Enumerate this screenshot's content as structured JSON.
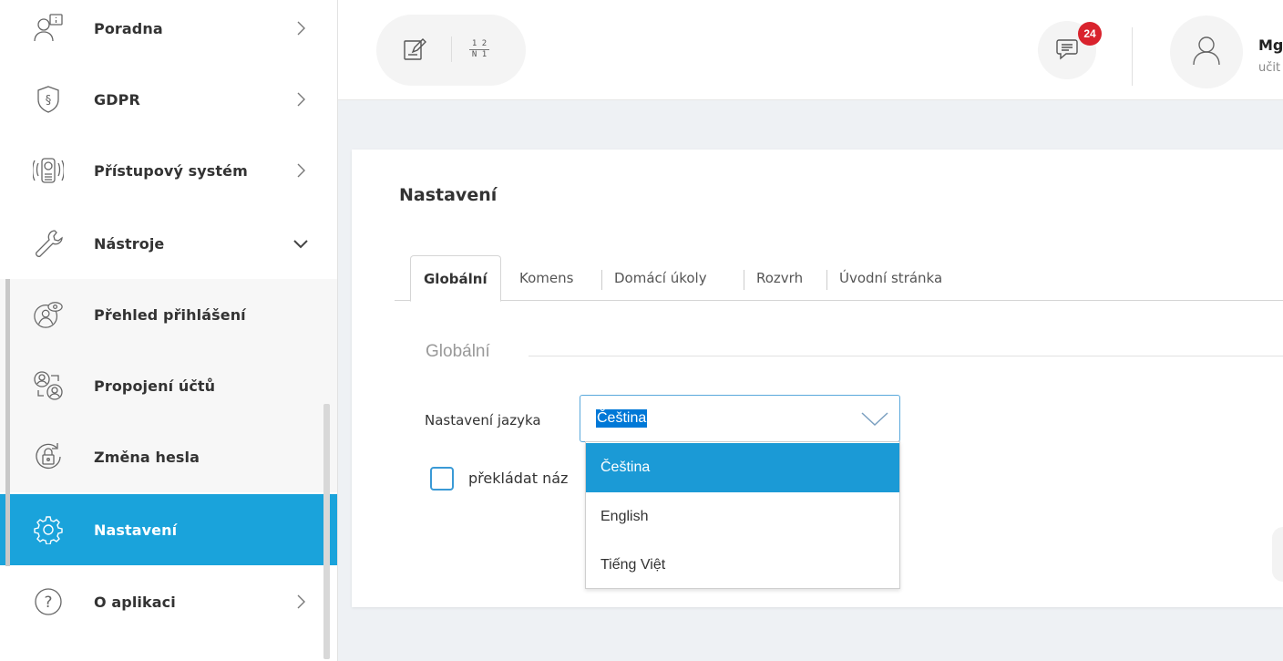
{
  "sidebar": {
    "items": [
      {
        "label": "Poradna",
        "icon": "advice-icon",
        "chevron": "right"
      },
      {
        "label": "GDPR",
        "icon": "gdpr-shield-icon",
        "chevron": "right"
      },
      {
        "label": "Přístupový systém",
        "icon": "access-system-icon",
        "chevron": "right"
      },
      {
        "label": "Nástroje",
        "icon": "wrench-icon",
        "chevron": "down"
      },
      {
        "label": "Přehled přihlášení",
        "icon": "login-overview-icon"
      },
      {
        "label": "Propojení účtů",
        "icon": "account-link-icon"
      },
      {
        "label": "Změna hesla",
        "icon": "password-change-icon"
      },
      {
        "label": "Nastavení",
        "icon": "gear-icon",
        "active": true
      },
      {
        "label": "O aplikaci",
        "icon": "help-icon",
        "chevron": "right"
      }
    ]
  },
  "topbar": {
    "tools": [
      {
        "icon": "edit-note-icon"
      },
      {
        "icon": "grade-numbers-icon",
        "text_top": "1 2",
        "text_bottom": "N 1"
      }
    ],
    "messages": {
      "icon": "message-icon",
      "count": "24"
    },
    "user": {
      "name": "Mg",
      "role": "učit",
      "icon": "user-avatar-icon"
    }
  },
  "page": {
    "title": "Nastavení",
    "tabs": [
      "Globální",
      "Komens",
      "Domácí úkoly",
      "Rozvrh",
      "Úvodní stránka"
    ],
    "active_tab": "Globální",
    "section_legend": "Globální",
    "language_field": {
      "label": "Nastavení jazyka",
      "value": "Čeština",
      "options": [
        "Čeština",
        "English",
        "Tiếng Việt"
      ],
      "selected_index": 0
    },
    "translate_checkbox": {
      "label": "překládat náz",
      "checked": false
    }
  },
  "colors": {
    "accent": "#1aa3db",
    "dropdown_selected": "#1b9ad6",
    "badge": "#d9232d"
  }
}
